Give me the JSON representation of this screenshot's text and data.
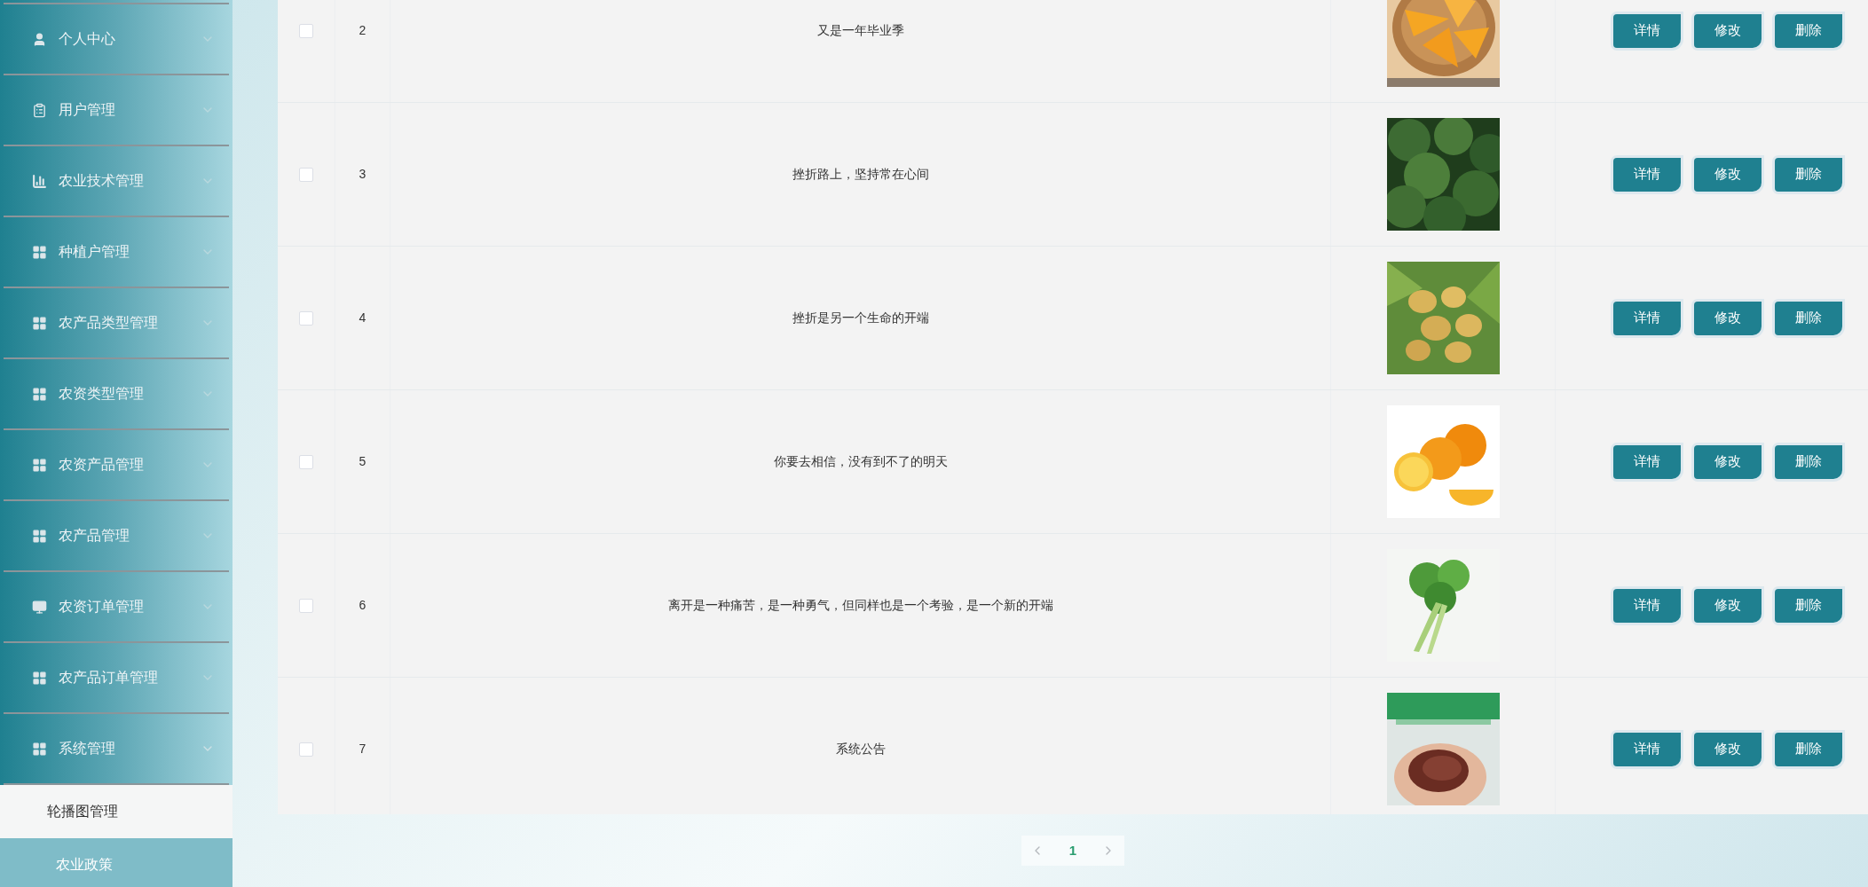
{
  "sidebar": {
    "items": [
      {
        "label": "个人中心",
        "kind": "person",
        "expanded": false
      },
      {
        "label": "用户管理",
        "kind": "clipboard",
        "expanded": false
      },
      {
        "label": "农业技术管理",
        "kind": "chart",
        "expanded": false
      },
      {
        "label": "种植户管理",
        "kind": "grid",
        "expanded": false
      },
      {
        "label": "农产品类型管理",
        "kind": "grid",
        "expanded": false
      },
      {
        "label": "农资类型管理",
        "kind": "grid",
        "expanded": false
      },
      {
        "label": "农资产品管理",
        "kind": "grid",
        "expanded": false
      },
      {
        "label": "农产品管理",
        "kind": "grid",
        "expanded": false
      },
      {
        "label": "农资订单管理",
        "kind": "monitor",
        "expanded": false
      },
      {
        "label": "农产品订单管理",
        "kind": "grid",
        "expanded": false
      },
      {
        "label": "系统管理",
        "kind": "grid",
        "expanded": true,
        "children": [
          {
            "label": "轮播图管理",
            "hovered": false
          },
          {
            "label": "农业政策",
            "hovered": true
          }
        ]
      }
    ]
  },
  "table": {
    "rows": [
      {
        "checked": false,
        "index": "2",
        "title": "又是一年毕业季",
        "actions": [
          "详情",
          "修改",
          "删除"
        ]
      },
      {
        "checked": false,
        "index": "3",
        "title": "挫折路上，坚持常在心间",
        "actions": [
          "详情",
          "修改",
          "删除"
        ]
      },
      {
        "checked": false,
        "index": "4",
        "title": "挫折是另一个生命的开端",
        "actions": [
          "详情",
          "修改",
          "删除"
        ]
      },
      {
        "checked": false,
        "index": "5",
        "title": "你要去相信，没有到不了的明天",
        "actions": [
          "详情",
          "修改",
          "删除"
        ]
      },
      {
        "checked": false,
        "index": "6",
        "title": "离开是一种痛苦，是一种勇气，但同样也是一个考验，是一个新的开端",
        "actions": [
          "详情",
          "修改",
          "删除"
        ]
      },
      {
        "checked": false,
        "index": "7",
        "title": "系统公告",
        "actions": [
          "详情",
          "修改",
          "删除"
        ]
      }
    ]
  },
  "pagination": {
    "pages": [
      {
        "label": "1",
        "selected": true
      }
    ]
  }
}
